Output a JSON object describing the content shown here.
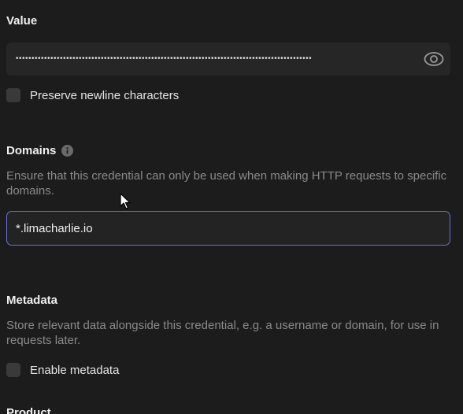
{
  "value_section": {
    "label": "Value",
    "masked_value": "••••••••••••••••••••••••••••••••••••••••••••••••••••••••••••••••••••••••••••••••••••••••••••••",
    "reveal_icon": "eye-icon"
  },
  "preserve_newlines": {
    "label": "Preserve newline characters",
    "checked": false
  },
  "domains_section": {
    "label": "Domains",
    "info_icon": "info-icon",
    "help": "Ensure that this credential can only be used when making HTTP requests to specific domains.",
    "input_value": "*.limacharlie.io"
  },
  "metadata_section": {
    "label": "Metadata",
    "help": "Store relevant data alongside this credential, e.g. a username or domain, for use in requests later.",
    "enable_label": "Enable metadata",
    "checked": false
  },
  "next_section": {
    "label": "Product"
  },
  "colors": {
    "background": "#1c1c1c",
    "focus_border": "#6b6fd6",
    "muted_text": "#8a8a8a"
  }
}
